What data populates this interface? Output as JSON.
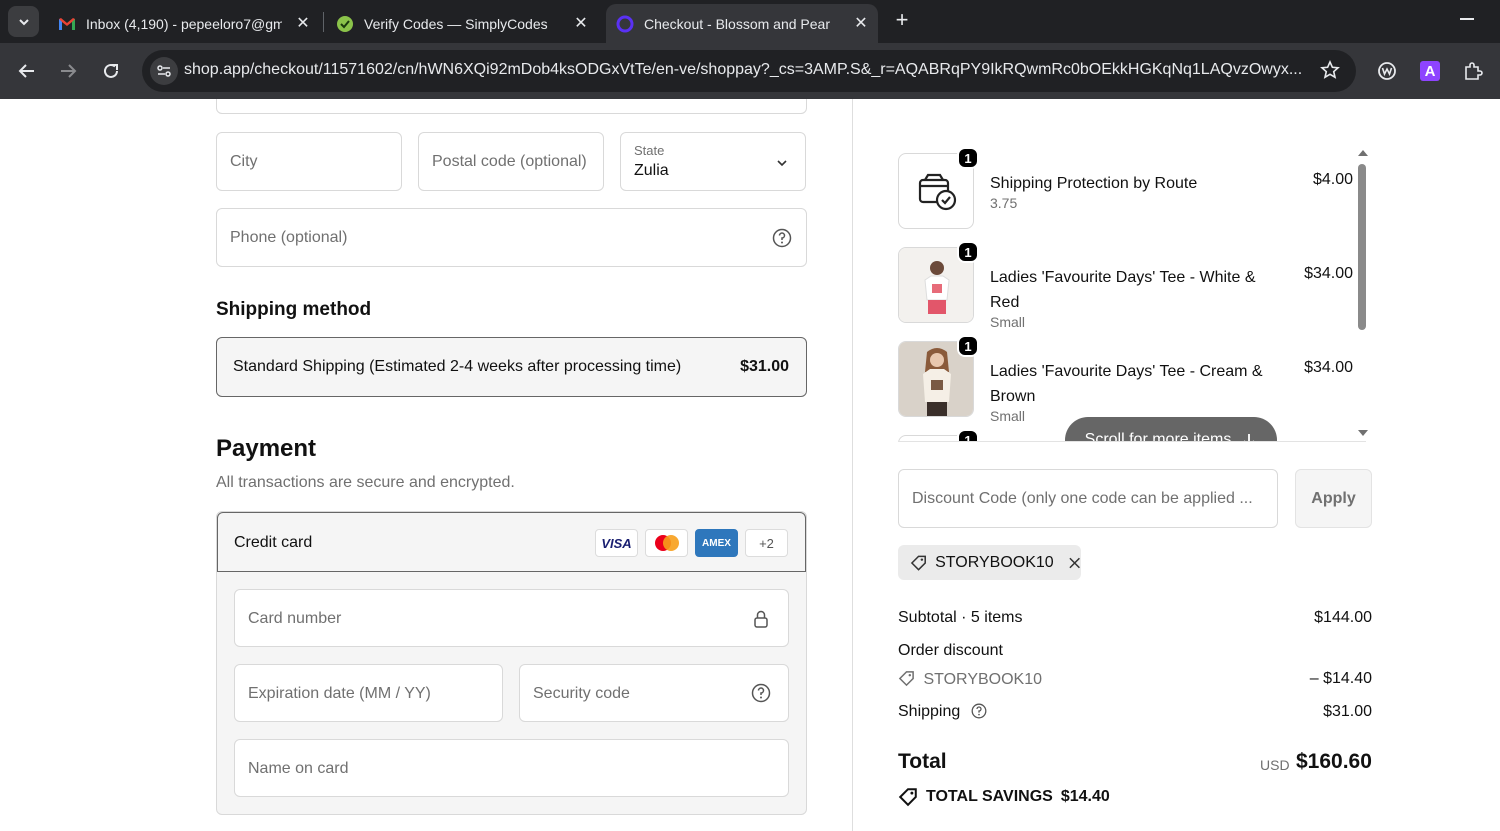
{
  "browser": {
    "tabs": [
      {
        "title": "Inbox (4,190) - pepeeloro7@gm",
        "favicon": "gmail-icon"
      },
      {
        "title": "Verify Codes — SimplyCodes",
        "favicon": "simplycodes-icon"
      },
      {
        "title": "Checkout - Blossom and Pear",
        "favicon": "shop-icon",
        "active": true
      }
    ],
    "url": "shop.app/checkout/11571602/cn/hWN6XQi92mDob4ksODGxVtTe/en-ve/shoppay?_cs=3AMP.S&_r=AQABRqPY9IkRQwmRc0bOEkkHGKqNq1LAQvzOwyx..."
  },
  "address": {
    "city_placeholder": "City",
    "postal_placeholder": "Postal code (optional)",
    "state_label": "State",
    "state_value": "Zulia",
    "phone_placeholder": "Phone (optional)"
  },
  "shipping": {
    "heading": "Shipping method",
    "option_name": "Standard Shipping (Estimated 2-4 weeks after processing time)",
    "option_price": "$31.00"
  },
  "payment": {
    "heading": "Payment",
    "subtitle": "All transactions are secure and encrypted.",
    "method": "Credit card",
    "card_brands": [
      "VISA",
      "mastercard",
      "AMEX"
    ],
    "more_brands": "+2",
    "card_number_placeholder": "Card number",
    "expiration_placeholder": "Expiration date (MM / YY)",
    "security_placeholder": "Security code",
    "name_placeholder": "Name on card"
  },
  "order": {
    "items": [
      {
        "qty": "1",
        "name": "Shipping Protection by Route",
        "variant": "3.75",
        "price": "$4.00"
      },
      {
        "qty": "1",
        "name": "Ladies 'Favourite Days' Tee - White & Red",
        "variant": "Small",
        "price": "$34.00"
      },
      {
        "qty": "1",
        "name": "Ladies 'Favourite Days' Tee - Cream & Brown",
        "variant": "Small",
        "price": "$34.00"
      },
      {
        "qty": "1"
      }
    ],
    "scroll_hint": "Scroll for more items",
    "discount_placeholder": "Discount Code (only one code can be applied ...",
    "apply_label": "Apply",
    "applied_code": "STORYBOOK10",
    "subtotal_label": "Subtotal · 5 items",
    "subtotal_value": "$144.00",
    "order_discount_label": "Order discount",
    "discount_code": "STORYBOOK10",
    "discount_value": "– $14.40",
    "shipping_label": "Shipping",
    "shipping_value": "$31.00",
    "total_label": "Total",
    "total_currency": "USD",
    "total_value": "$160.60",
    "savings_label": "TOTAL SAVINGS",
    "savings_value": "$14.40"
  }
}
